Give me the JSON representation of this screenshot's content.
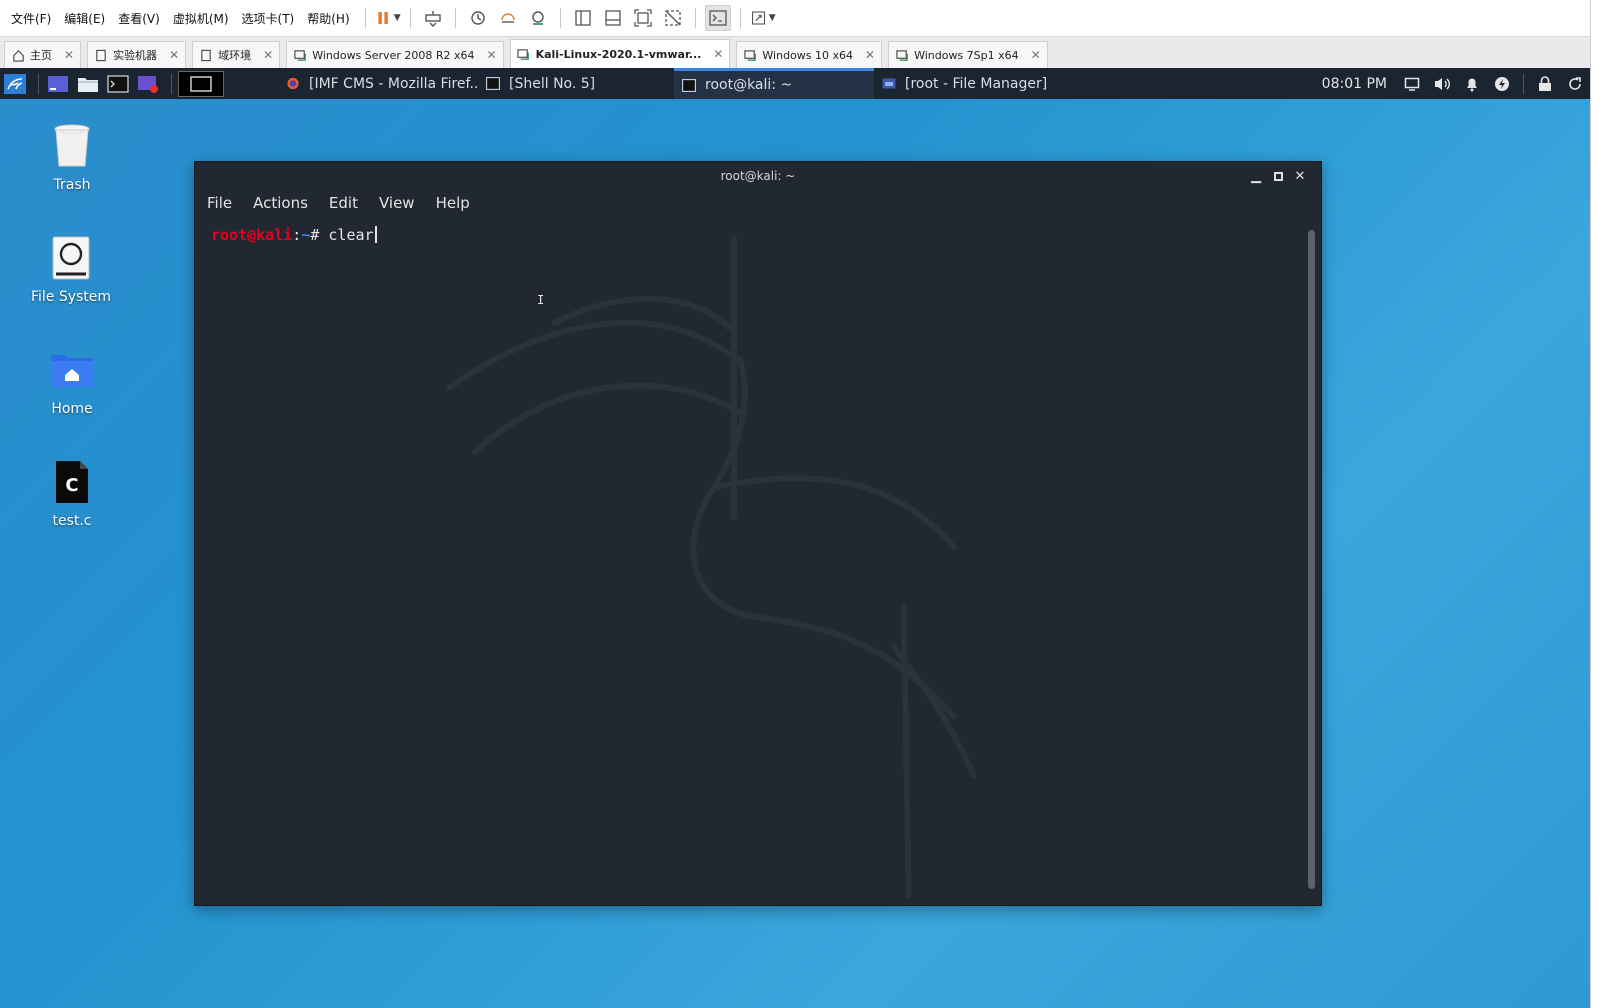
{
  "vmware": {
    "menu": [
      "文件(F)",
      "编辑(E)",
      "查看(V)",
      "虚拟机(M)",
      "选项卡(T)",
      "帮助(H)"
    ],
    "tabs": [
      {
        "label": "主页",
        "icon": "home-icon",
        "active": false
      },
      {
        "label": "实验机器",
        "icon": "document-icon",
        "active": false
      },
      {
        "label": "域环境",
        "icon": "document-icon",
        "active": false
      },
      {
        "label": "Windows Server 2008 R2 x64",
        "icon": "vm-icon",
        "active": false
      },
      {
        "label": "Kali-Linux-2020.1-vmwar...",
        "icon": "vm-icon",
        "active": true
      },
      {
        "label": "Windows 10 x64",
        "icon": "vm-icon",
        "active": false
      },
      {
        "label": "Windows 7Sp1 x64",
        "icon": "vm-icon",
        "active": false
      }
    ]
  },
  "panel": {
    "tasks": [
      {
        "label": "[IMF CMS - Mozilla Firef...",
        "icon": "firefox-icon",
        "active": false
      },
      {
        "label": "[Shell No. 5]",
        "icon": "terminal-icon",
        "active": false
      },
      {
        "label": "root@kali: ~",
        "icon": "terminal-icon",
        "active": true
      },
      {
        "label": "[root - File Manager]",
        "icon": "folder-icon",
        "active": false
      }
    ],
    "clock": "08:01 PM"
  },
  "desktop": {
    "icons": [
      {
        "label": "Trash",
        "icon": "trash-icon"
      },
      {
        "label": "File System",
        "icon": "drive-icon"
      },
      {
        "label": "Home",
        "icon": "home-folder-icon"
      },
      {
        "label": "test.c",
        "icon": "c-source-file-icon"
      }
    ]
  },
  "terminal": {
    "title": "root@kali: ~",
    "menu": [
      "File",
      "Actions",
      "Edit",
      "View",
      "Help"
    ],
    "prompt": {
      "user_host": "root@kali",
      "colon": ":",
      "path": "~",
      "symbol": "# "
    },
    "command": "clear",
    "colors": {
      "user": "#e6001f",
      "path": "#3b82f6",
      "background": "#222831"
    }
  },
  "colors": {
    "desktop_bg": "#2293cf",
    "panel_bg": "#1b2431",
    "accent": "#3a86e0"
  }
}
